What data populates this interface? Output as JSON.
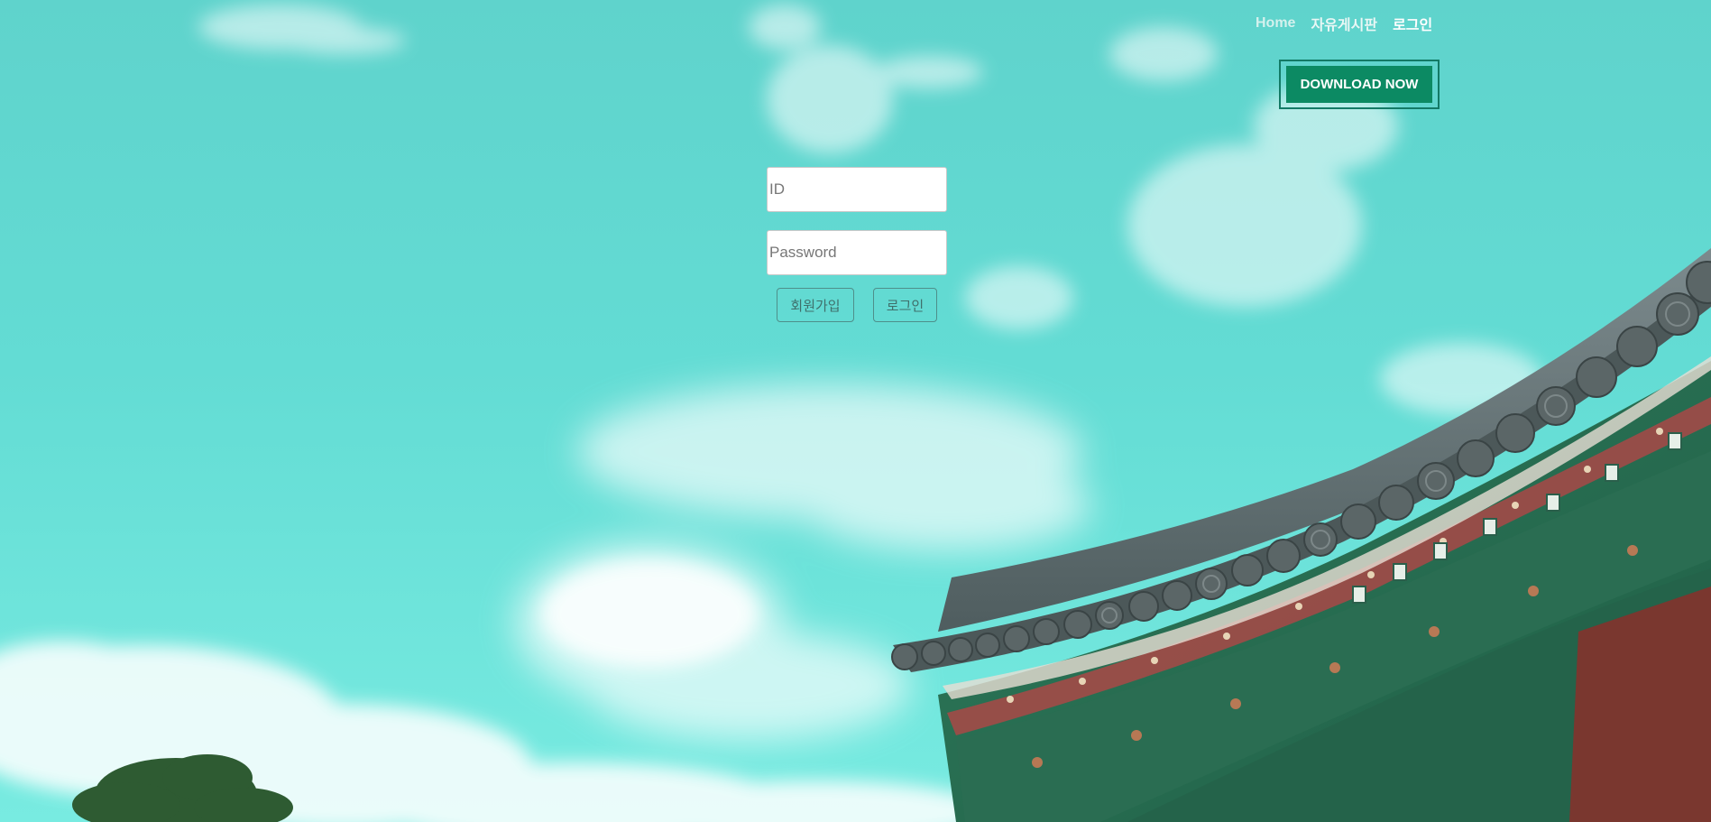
{
  "nav": {
    "home_label": "Home",
    "board_label": "자유게시판",
    "login_label": "로그인"
  },
  "header": {
    "download_label": "DOWNLOAD NOW"
  },
  "form": {
    "id_placeholder": "ID",
    "password_placeholder": "Password",
    "signup_label": "회원가입",
    "login_label": "로그인"
  },
  "colors": {
    "sky": "#62ddd5",
    "download_bg": "#0c8a63",
    "download_border": "#137a66",
    "outline_button_border": "#4e8f8a",
    "roof_tile": "#5f6f70",
    "roof_green": "#2f7a5b",
    "roof_red": "#a24a47"
  },
  "icons": {
    "background": "sky-and-hanok-roof-image"
  }
}
